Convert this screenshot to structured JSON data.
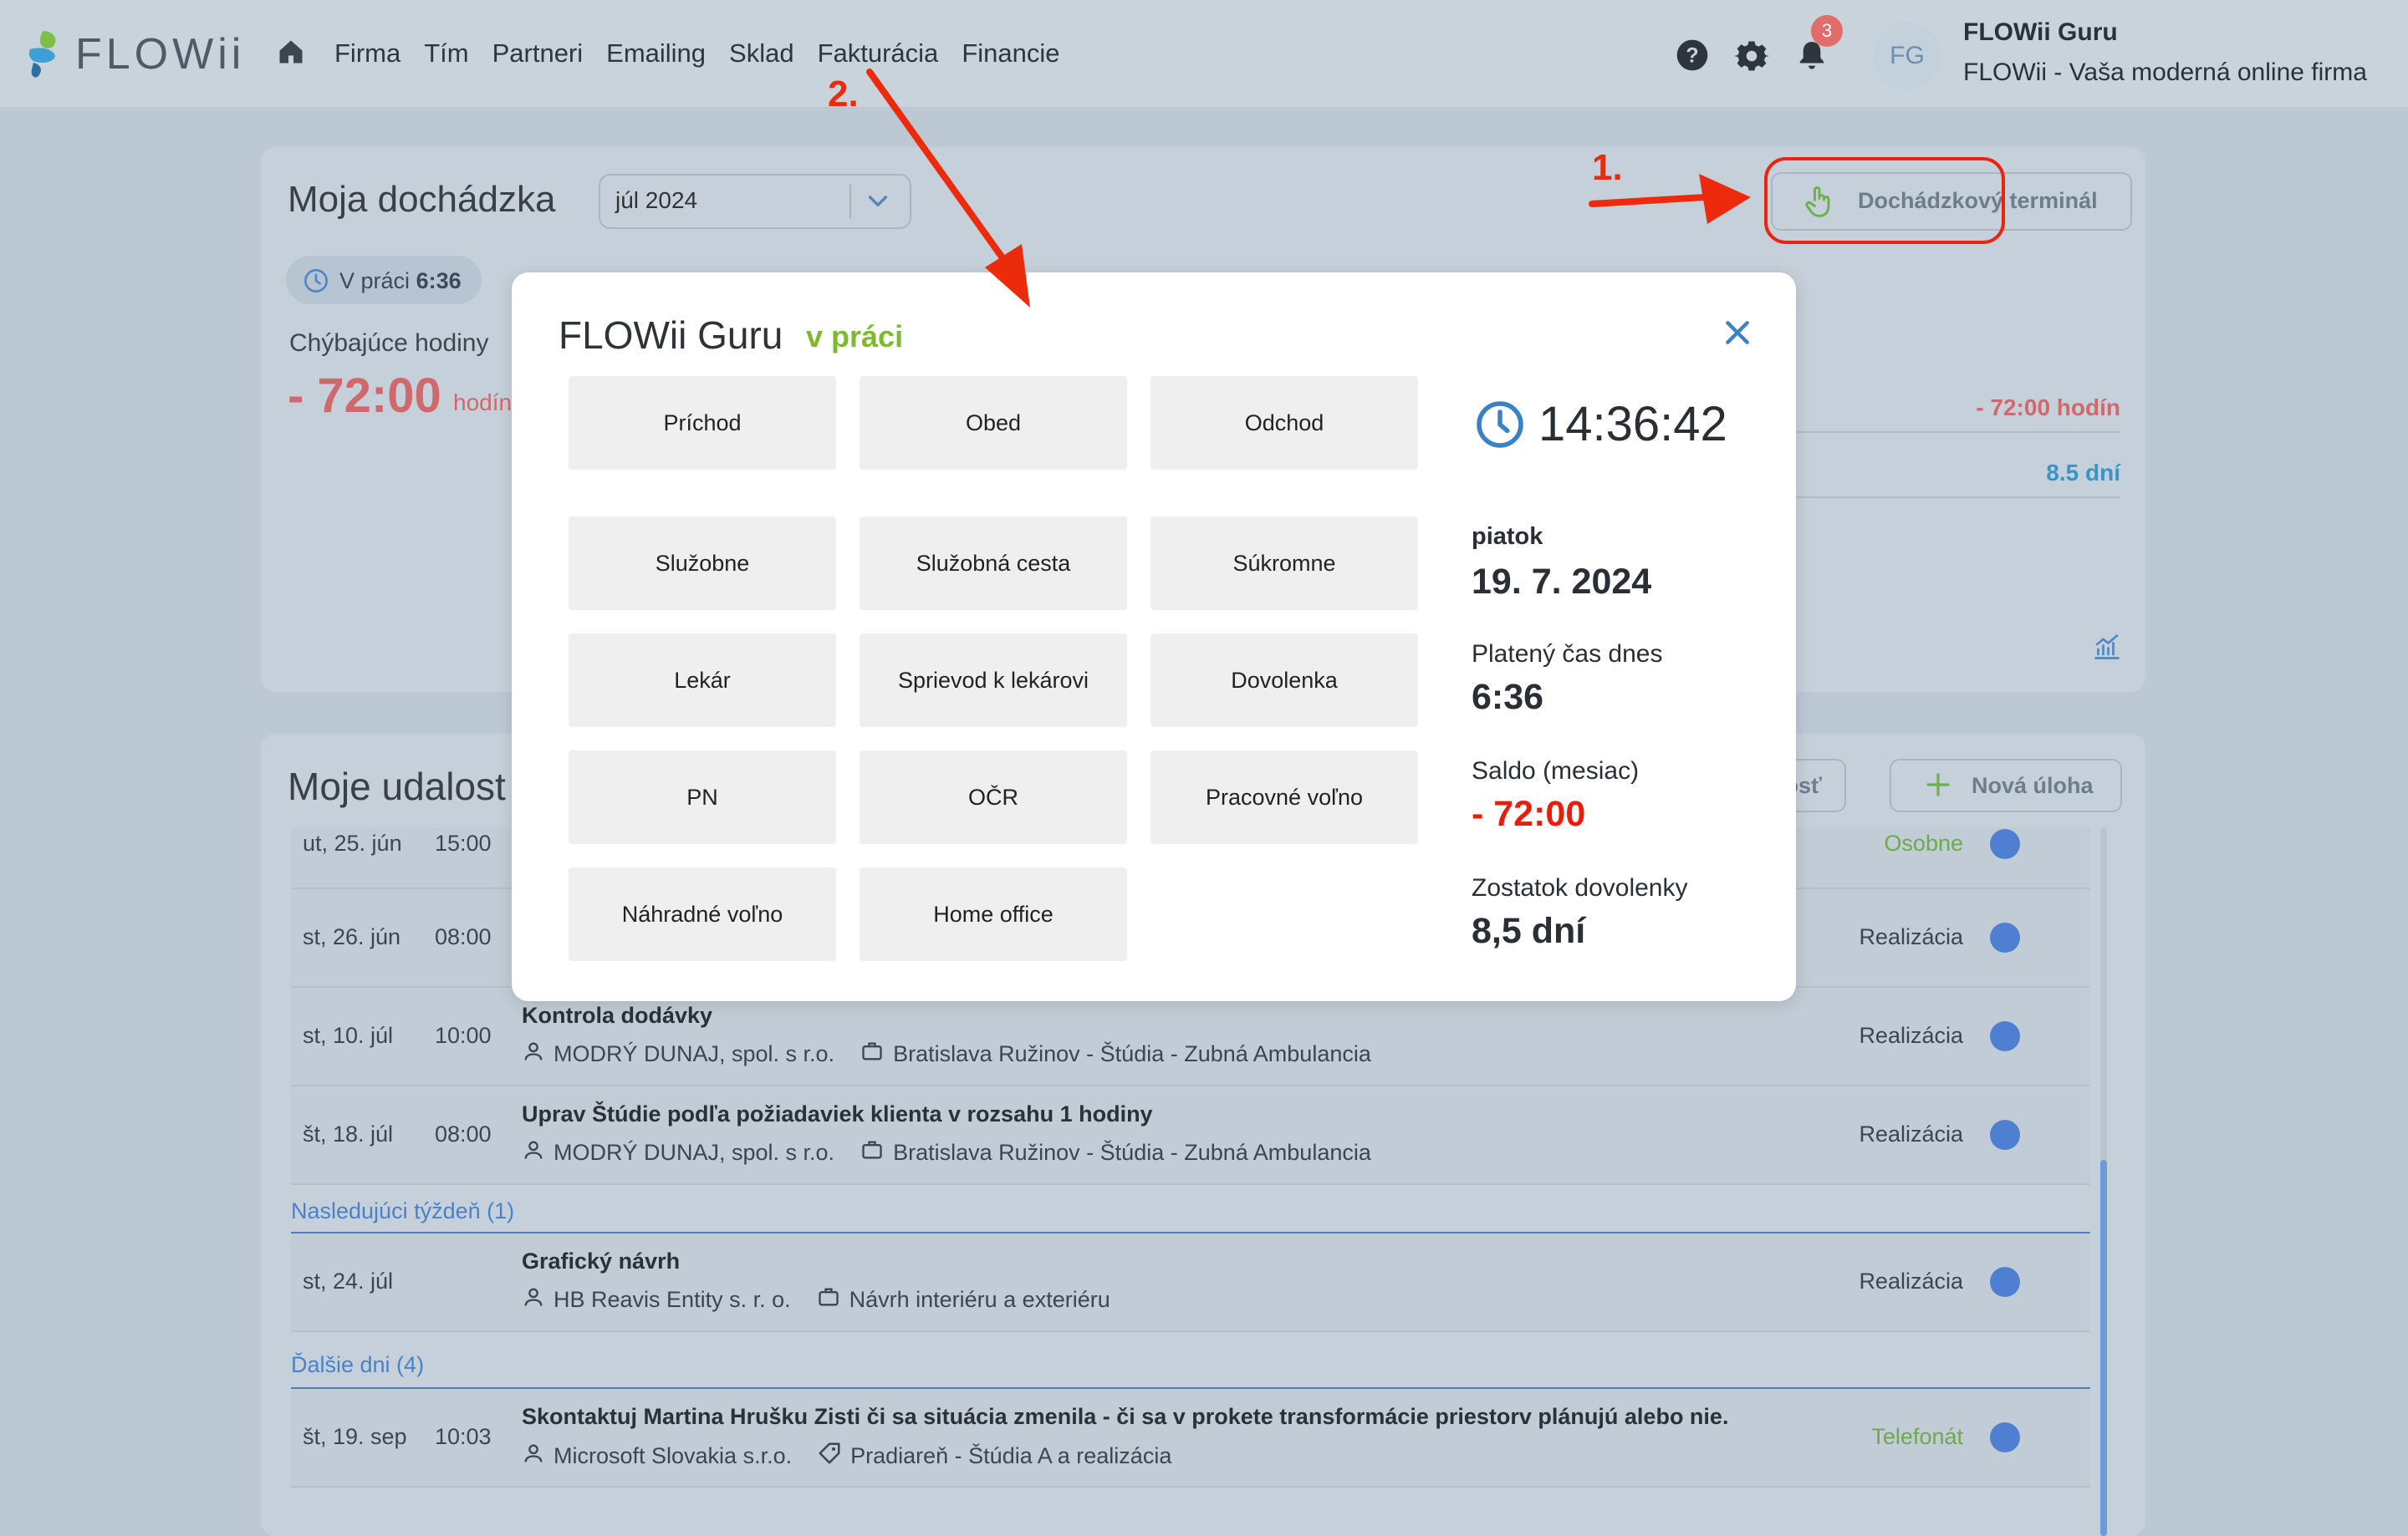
{
  "app": {
    "logo_text": "FLOWii"
  },
  "nav": {
    "items": [
      "Firma",
      "Tím",
      "Partneri",
      "Emailing",
      "Sklad",
      "Fakturácia",
      "Financie"
    ]
  },
  "topbar": {
    "notif_count": "3",
    "avatar_initials": "FG",
    "user_name": "FLOWii Guru",
    "user_company": "FLOWii - Vaša moderná online firma"
  },
  "attendance": {
    "title": "Moja dochádzka",
    "month": "júl 2024",
    "terminal_button": "Dochádzkový terminál",
    "status_prefix": "V práci",
    "status_time": "6:36",
    "missing_label": "Chýbajúce hodiny",
    "missing_value": "- 72:00",
    "missing_unit": "hodín",
    "right_stat_1": "- 72:00 hodín",
    "right_stat_2": "8.5 dní"
  },
  "events": {
    "title": "Moje udalost",
    "btn_event_partial": "alosť",
    "btn_new_task": "Nová úloha",
    "rows_top": [
      {
        "date": "ut, 25. jún",
        "time": "15:00",
        "type": "Osobne"
      },
      {
        "date": "st, 26. jún",
        "time": "08:00",
        "type": "Realizácia"
      },
      {
        "date": "st, 10. júl",
        "time": "10:00",
        "name": "Kontrola dodávky",
        "client": "MODRÝ DUNAJ, spol. s r.o.",
        "project": "Bratislava Ružinov - Štúdia - Zubná Ambulancia",
        "type": "Realizácia"
      },
      {
        "date": "št, 18. júl",
        "time": "08:00",
        "name": "Uprav Štúdie podľa požiadaviek klienta v rozsahu 1 hodiny",
        "client": "MODRÝ DUNAJ, spol. s r.o.",
        "project": "Bratislava Ružinov - Štúdia - Zubná Ambulancia",
        "type": "Realizácia"
      }
    ],
    "group_next_week": "Nasledujúci týždeň (1)",
    "row_next": {
      "date": "st, 24. júl",
      "name": "Grafický návrh",
      "client": "HB Reavis Entity s. r. o.",
      "project": "Návrh interiéru a exteriéru",
      "type": "Realizácia"
    },
    "group_other": "Ďalšie dni (4)",
    "row_other": {
      "date": "št, 19. sep",
      "time": "10:03",
      "name": "Skontaktuj Martina Hrušku Zisti či sa situácia zmenila - či sa v prokete transformácie priestorv plánujú alebo nie.",
      "client": "Microsoft Slovakia s.r.o.",
      "project": "Pradiareň - Štúdia A a realizácia",
      "type": "Telefonát"
    }
  },
  "modal": {
    "user_name": "FLOWii Guru",
    "status": "v práci",
    "buttons": [
      "Príchod",
      "Obed",
      "Odchod",
      "Služobne",
      "Služobná cesta",
      "Súkromne",
      "Lekár",
      "Sprievod k lekárovi",
      "Dovolenka",
      "PN",
      "OČR",
      "Pracovné voľno",
      "Náhradné voľno",
      "Home office"
    ],
    "clock": "14:36:42",
    "weekday": "piatok",
    "date": "19. 7. 2024",
    "paid_label": "Platený čas dnes",
    "paid_value": "6:36",
    "saldo_label": "Saldo (mesiac)",
    "saldo_value": "- 72:00",
    "vacation_label": "Zostatok dovolenky",
    "vacation_value": "8,5 dní"
  },
  "annotations": {
    "step1": "1.",
    "step2": "2."
  },
  "colors": {
    "accent_red": "#ec1d08",
    "status_green": "#7dbb2e",
    "brand_blue": "#4a82c7"
  }
}
